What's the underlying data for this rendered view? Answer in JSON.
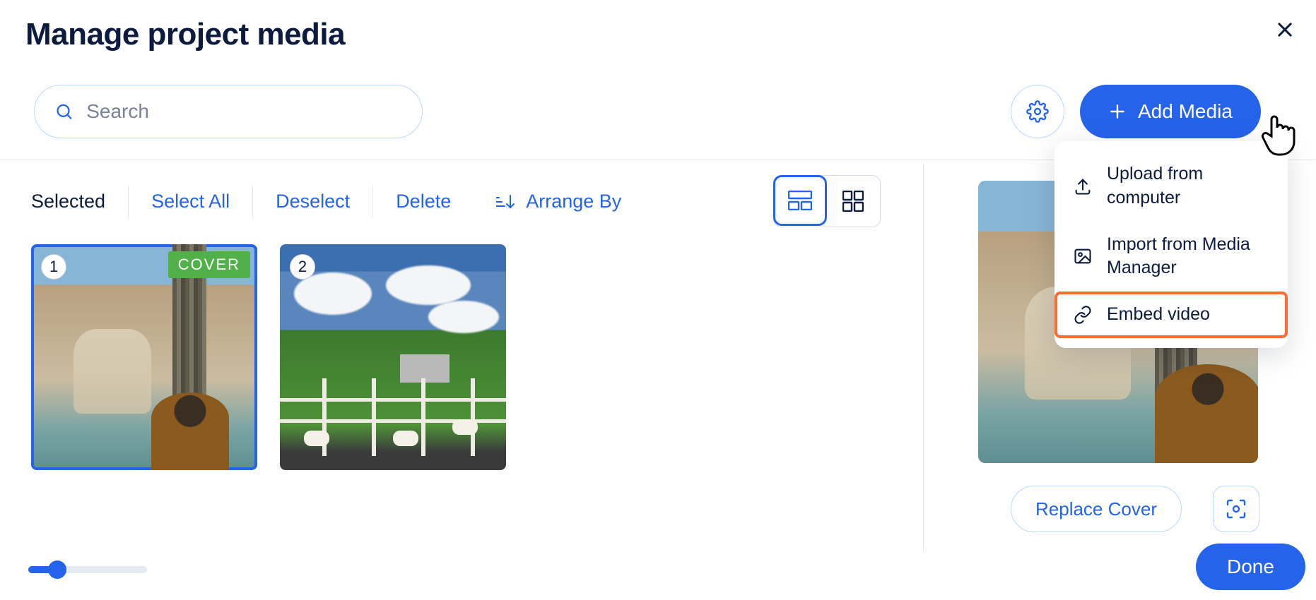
{
  "header": {
    "title": "Manage project media"
  },
  "search": {
    "placeholder": "Search",
    "value": ""
  },
  "actions": {
    "add_media_label": "Add Media",
    "gear_icon": "gear-icon"
  },
  "dropdown": {
    "items": [
      {
        "icon": "upload-icon",
        "label": "Upload from computer"
      },
      {
        "icon": "image-icon",
        "label": "Import from Media Manager"
      },
      {
        "icon": "link-icon",
        "label": "Embed video",
        "highlighted": true
      }
    ]
  },
  "toolbar": {
    "selected_label": "Selected",
    "select_all_label": "Select All",
    "deselect_label": "Deselect",
    "delete_label": "Delete",
    "arrange_label": "Arrange By"
  },
  "view": {
    "active": "masonry"
  },
  "media_items": [
    {
      "index": "1",
      "is_cover": true,
      "cover_label": "COVER",
      "selected": true
    },
    {
      "index": "2",
      "is_cover": false,
      "selected": false
    }
  ],
  "sidebar": {
    "replace_cover_label": "Replace Cover"
  },
  "footer": {
    "done_label": "Done"
  },
  "colors": {
    "primary": "#2563eb",
    "highlight": "#ff6b35",
    "cover_badge": "#51b04a"
  }
}
